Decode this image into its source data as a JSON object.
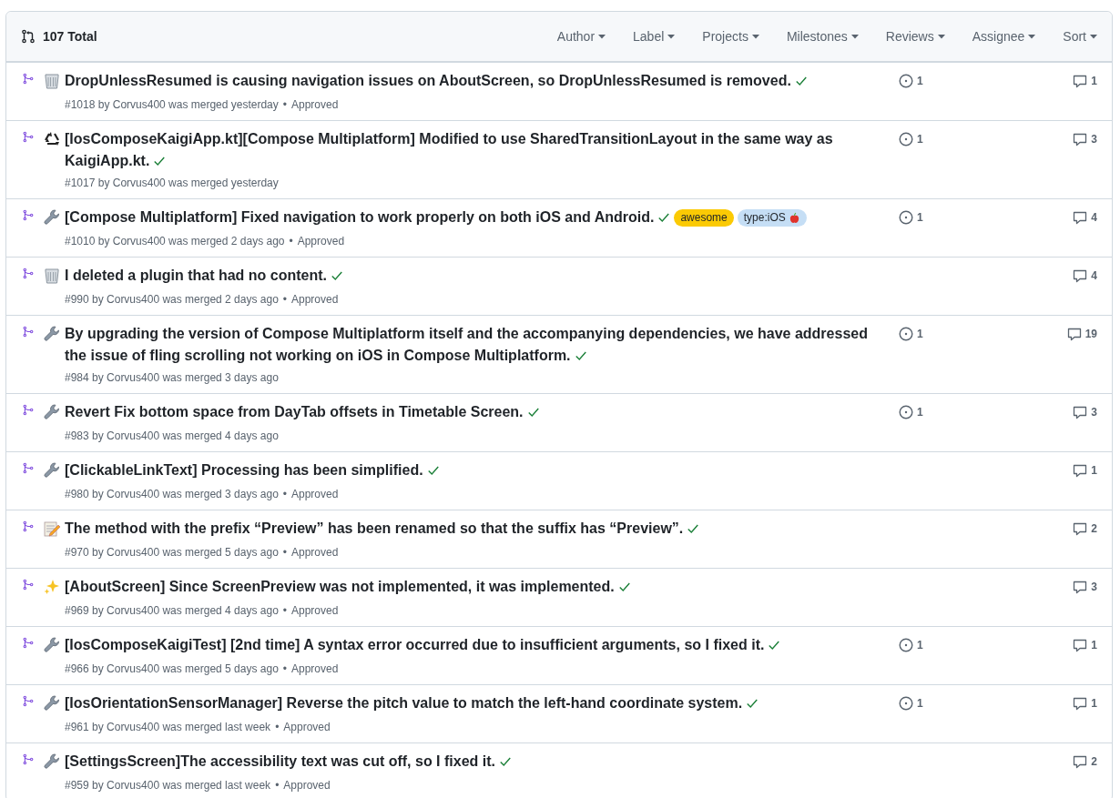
{
  "header": {
    "total": "107 Total",
    "filters": [
      "Author",
      "Label",
      "Projects",
      "Milestones",
      "Reviews",
      "Assignee",
      "Sort"
    ]
  },
  "pull_requests": [
    {
      "kind": "trash",
      "title": "DropUnlessResumed is causing navigation issues on AboutScreen, so DropUnlessResumed is removed.",
      "checks_passed": true,
      "meta": "#1018 by Corvus400 was merged yesterday",
      "review": {
        "separator": "•",
        "status": "Approved"
      },
      "linked_issues": "1",
      "comments": "1"
    },
    {
      "kind": "recycle",
      "title": "[IosComposeKaigiApp.kt][Compose Multiplatform] Modified to use SharedTransitionLayout in the same way as KaigiApp.kt.",
      "checks_passed": true,
      "meta": "#1017 by Corvus400 was merged yesterday",
      "linked_issues": "1",
      "comments": "3"
    },
    {
      "kind": "wrench",
      "title": "[Compose Multiplatform] Fixed navigation to work properly on both iOS and Android.",
      "checks_passed": true,
      "labels": [
        {
          "kind": "plain",
          "name": "awesome",
          "color": "#fbca04"
        },
        {
          "kind": "platform",
          "name": "type:iOS",
          "color": "#c5def5"
        }
      ],
      "meta": "#1010 by Corvus400 was merged 2 days ago",
      "review": {
        "separator": "•",
        "status": "Approved"
      },
      "linked_issues": "1",
      "comments": "4"
    },
    {
      "kind": "trash",
      "title": "I deleted a plugin that had no content.",
      "checks_passed": true,
      "meta": "#990 by Corvus400 was merged 2 days ago",
      "review": {
        "separator": "•",
        "status": "Approved"
      },
      "comments": "4"
    },
    {
      "kind": "wrench",
      "title": "By upgrading the version of Compose Multiplatform itself and the accompanying dependencies, we have addressed the issue of fling scrolling not working on iOS in Compose Multiplatform.",
      "checks_passed": true,
      "meta": "#984 by Corvus400 was merged 3 days ago",
      "linked_issues": "1",
      "comments": "19"
    },
    {
      "kind": "wrench",
      "title": "Revert Fix bottom space from DayTab offsets in Timetable Screen.",
      "checks_passed": true,
      "meta": "#983 by Corvus400 was merged 4 days ago",
      "linked_issues": "1",
      "comments": "3"
    },
    {
      "kind": "wrench",
      "title": "[ClickableLinkText] Processing has been simplified.",
      "checks_passed": true,
      "meta": "#980 by Corvus400 was merged 3 days ago",
      "review": {
        "separator": "•",
        "status": "Approved"
      },
      "comments": "1"
    },
    {
      "kind": "memo",
      "title": "The method with the prefix “Preview” has been renamed so that the suffix has “Preview”.",
      "checks_passed": true,
      "meta": "#970 by Corvus400 was merged 5 days ago",
      "review": {
        "separator": "•",
        "status": "Approved"
      },
      "comments": "2"
    },
    {
      "kind": "sparkles",
      "title": "[AboutScreen] Since ScreenPreview was not implemented, it was implemented.",
      "checks_passed": true,
      "meta": "#969 by Corvus400 was merged 4 days ago",
      "review": {
        "separator": "•",
        "status": "Approved"
      },
      "comments": "3"
    },
    {
      "kind": "wrench",
      "title": "[IosComposeKaigiTest] [2nd time] A syntax error occurred due to insufficient arguments, so I fixed it.",
      "checks_passed": true,
      "meta": "#966 by Corvus400 was merged 5 days ago",
      "review": {
        "separator": "•",
        "status": "Approved"
      },
      "linked_issues": "1",
      "comments": "1"
    },
    {
      "kind": "wrench",
      "title": "[IosOrientationSensorManager] Reverse the pitch value to match the left-hand coordinate system.",
      "checks_passed": true,
      "meta": "#961 by Corvus400 was merged last week",
      "review": {
        "separator": "•",
        "status": "Approved"
      },
      "linked_issues": "1",
      "comments": "1"
    },
    {
      "kind": "wrench",
      "title": "[SettingsScreen]The accessibility text was cut off, so I fixed it.",
      "checks_passed": true,
      "meta": "#959 by Corvus400 was merged last week",
      "review": {
        "separator": "•",
        "status": "Approved"
      },
      "comments": "2"
    }
  ]
}
